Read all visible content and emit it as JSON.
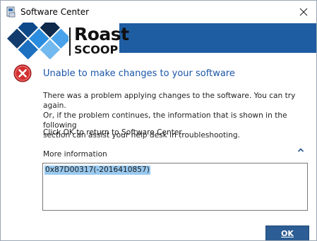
{
  "window": {
    "title": "Software Center",
    "close_glyph": "✕"
  },
  "banner": {
    "logo_word_1": "Roast",
    "logo_word_2": "SCOOP",
    "bar_color": "#1f5da3"
  },
  "error": {
    "icon": "error-x-icon",
    "heading": "Unable to make changes to your software",
    "message_line_1": "There was a problem applying changes to the software.  You can try again.",
    "message_line_2": "Or, if the problem continues, the information that is shown in the following",
    "message_line_3": "section can assist your help desk in troubleshooting.",
    "click_ok": "Click OK to return to Software Center."
  },
  "more_info": {
    "label": "More information",
    "collapse_icon": "chevron-up-icon",
    "code": "0x87D00317(-2016410857)"
  },
  "buttons": {
    "ok_label": "OK",
    "ok_color": "#2c5d94"
  },
  "colors": {
    "heading": "#1a55a8",
    "selection": "#99c9ef",
    "error_red": "#c62828"
  }
}
